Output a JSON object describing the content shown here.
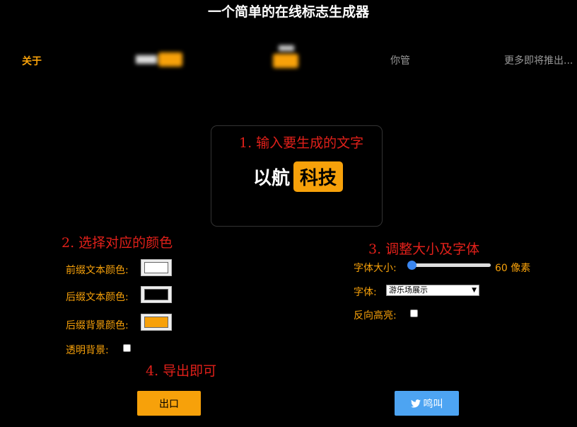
{
  "page_title": "一个简单的在线标志生成器",
  "nav": {
    "about": "关于",
    "item_you": "你管",
    "item_more": "更多即将推出..."
  },
  "logo": {
    "prefix": "以航",
    "suffix": "科技"
  },
  "steps": {
    "step1": "1. 输入要生成的文字",
    "step2": "2. 选择对应的颜色",
    "step3": "3. 调整大小及字体",
    "step4": "4. 导出即可"
  },
  "colors_panel": {
    "prefix_text_color_label": "前缀文本颜色:",
    "prefix_text_color": "#ffffff",
    "suffix_text_color_label": "后缀文本颜色:",
    "suffix_text_color": "#000000",
    "suffix_bg_color_label": "后缀背景颜色:",
    "suffix_bg_color": "#f7a10a",
    "transparent_bg_label": "透明背景:"
  },
  "size_panel": {
    "font_size_label": "字体大小:",
    "font_size_value": "60 像素",
    "slider_fraction": 0.0,
    "font_label": "字体:",
    "font_selected": "游乐场展示",
    "reverse_label": "反向高亮:"
  },
  "buttons": {
    "export": "出口",
    "tweet": "鸣叫"
  },
  "accent_color": "#f7a10a",
  "twitter_color": "#4da4f2"
}
